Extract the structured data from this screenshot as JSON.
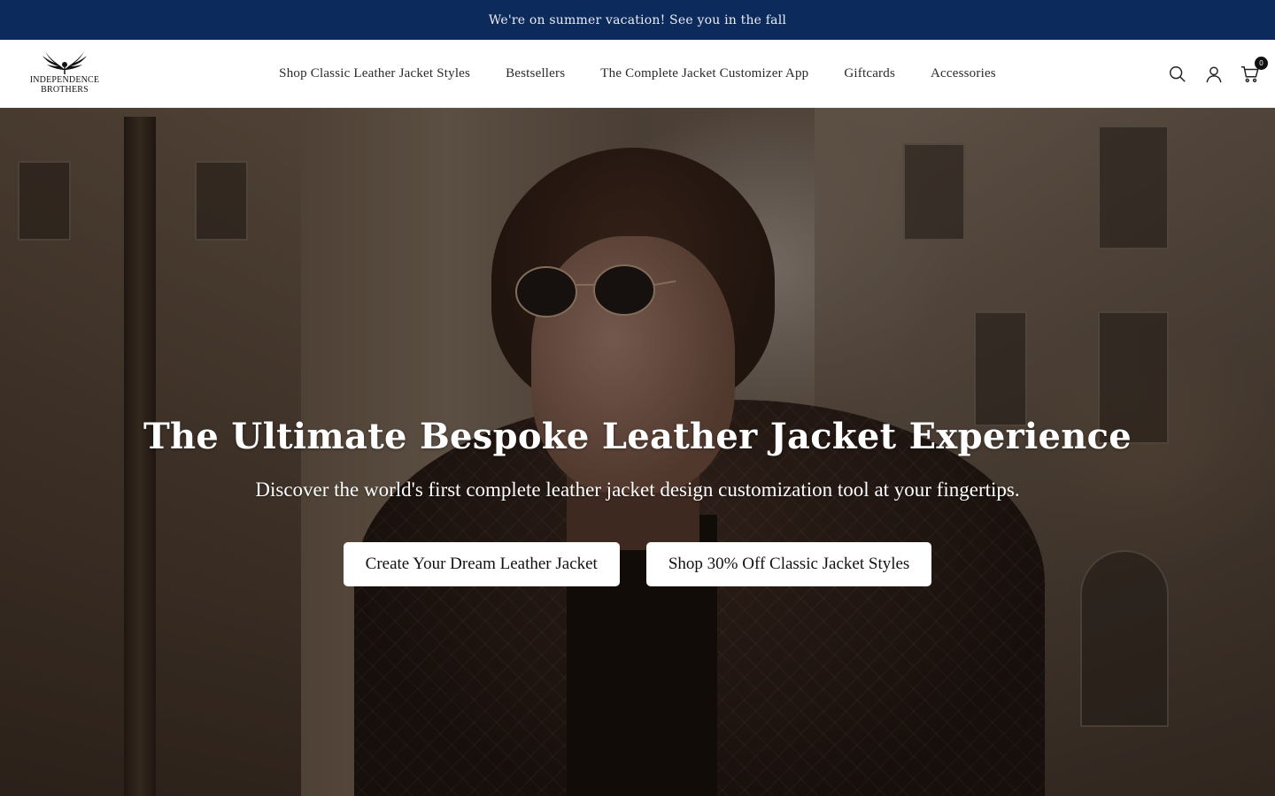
{
  "announcement": {
    "text": "We're on summer vacation! See you in the fall"
  },
  "header": {
    "logo": {
      "line1": "INDEPENDENCE",
      "line2": "BROTHERS",
      "icon": "wings-bird-logo-icon"
    },
    "nav": [
      {
        "label": "Shop Classic Leather Jacket Styles"
      },
      {
        "label": "Bestsellers"
      },
      {
        "label": "The Complete Jacket Customizer App"
      },
      {
        "label": "Giftcards"
      },
      {
        "label": "Accessories"
      }
    ],
    "icons": {
      "search": "search-icon",
      "account": "account-icon",
      "cart": "cart-icon"
    },
    "cart_count": "0"
  },
  "hero": {
    "title": "The Ultimate Bespoke Leather Jacket Experience",
    "subtitle": "Discover the world's first complete leather jacket design customization tool at your fingertips.",
    "primary_button": "Create Your Dream Leather Jacket",
    "secondary_button": "Shop 30% Off Classic Jacket Styles"
  },
  "colors": {
    "announcement_bg": "#0d2a5c",
    "announcement_text": "#e8ecf3",
    "header_bg": "#ffffff",
    "nav_text": "#2a2a2a",
    "button_bg": "#ffffff",
    "hero_text": "#ffffff"
  }
}
